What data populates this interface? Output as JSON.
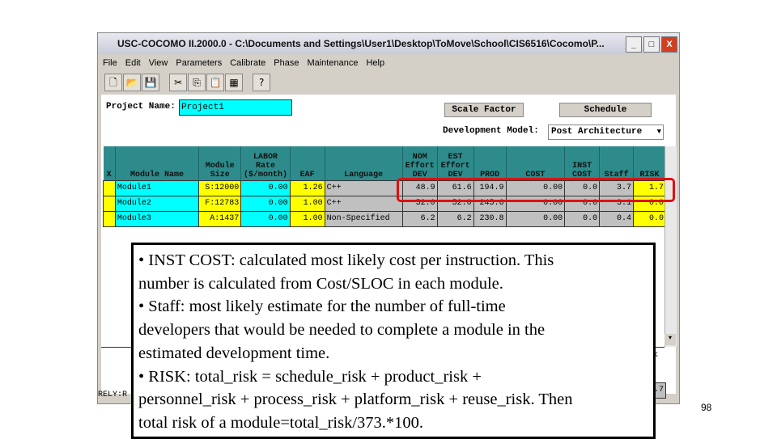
{
  "window": {
    "title": "USC-COCOMO II.2000.0 - C:\\Documents and Settings\\User1\\Desktop\\ToMove\\School\\CIS6516\\Cocomo\\P..."
  },
  "menu": [
    "File",
    "Edit",
    "View",
    "Parameters",
    "Calibrate",
    "Phase",
    "Maintenance",
    "Help"
  ],
  "toolbar": {
    "icons": [
      "new-icon",
      "open-icon",
      "save-icon",
      "cut-icon",
      "copy-icon",
      "paste-icon",
      "table-icon",
      "help-icon"
    ]
  },
  "form": {
    "project_label": "Project Name:",
    "project_value": "Project1",
    "scale_factor": "Scale Factor",
    "schedule": "Schedule",
    "dev_model_label": "Development Model:",
    "dev_model_value": "Post Architecture"
  },
  "table": {
    "headers": [
      "X",
      "Module Name",
      "Module Size",
      "LABOR Rate ($/month)",
      "EAF",
      "Language",
      "NOM Effort DEV",
      "EST Effort DEV",
      "PROD",
      "COST",
      "INST COST",
      "Staff",
      "RISK"
    ],
    "rows": [
      [
        "",
        "Module1",
        "S:12000",
        "0.00",
        "1.26",
        "C++",
        "48.9",
        "61.6",
        "194.9",
        "0.00",
        "0.0",
        "3.7",
        "1.7"
      ],
      [
        "",
        "Module2",
        "F:12783",
        "0.00",
        "1.00",
        "C++",
        "52.0",
        "52.0",
        "245.6",
        "0.00",
        "0.0",
        "3.1",
        "0.0"
      ],
      [
        "",
        "Module3",
        "A:1437",
        "0.00",
        "1.00",
        "Non-Specified",
        "6.2",
        "6.2",
        "230.8",
        "0.00",
        "0.0",
        "0.4",
        "0.0"
      ]
    ]
  },
  "bottom": {
    "status": "RELY:R",
    "side_k": "k",
    "side_val": ".7"
  },
  "overlay": {
    "lines": [
      "• INST COST: calculated most likely cost per instruction. This",
      "number is calculated from Cost/SLOC in each module.",
      "• Staff: most likely estimate for the number of full-time",
      "developers that would be needed to complete a module in the",
      "estimated development time.",
      "• RISK: total_risk = schedule_risk + product_risk +",
      "personnel_risk + process_risk + platform_risk + reuse_risk. Then",
      "total risk of a module=total_risk/373.*100."
    ]
  },
  "page_number": "98",
  "colors": {
    "header": "#2e8b8b",
    "cyan": "#00ffff",
    "yellow": "#ffff00",
    "highlight": "#e01010"
  }
}
